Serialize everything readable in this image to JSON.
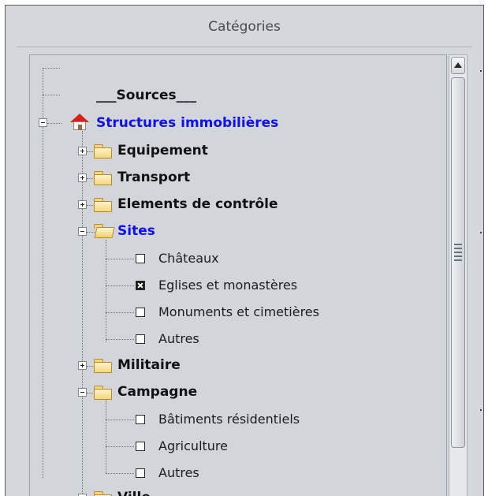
{
  "panel": {
    "title": "Catégories"
  },
  "tree": {
    "sources_label": "___Sources___",
    "root_label": "Structures immobilières",
    "items": {
      "equipement": "Equipement",
      "transport": "Transport",
      "elements": "Elements de contrôle",
      "sites": "Sites",
      "sites_children": [
        "Châteaux",
        "Eglises et monastères",
        "Monuments et cimetières",
        "Autres"
      ],
      "militaire": "Militaire",
      "campagne": "Campagne",
      "campagne_children": [
        "Bâtiments résidentiels",
        "Agriculture",
        "Autres"
      ],
      "ville": "Ville"
    },
    "checked": {
      "sites_children": [
        false,
        true,
        false,
        false
      ],
      "campagne_children": [
        false,
        false,
        false
      ]
    }
  },
  "icons": {
    "root": "house-icon",
    "folder": "folder-icon",
    "folder_open": "folder-open-icon",
    "expand": "plus-box-icon",
    "collapse": "minus-box-icon"
  },
  "colors": {
    "selected_text": "#1010ee",
    "panel_bg": "#d4d7db"
  }
}
